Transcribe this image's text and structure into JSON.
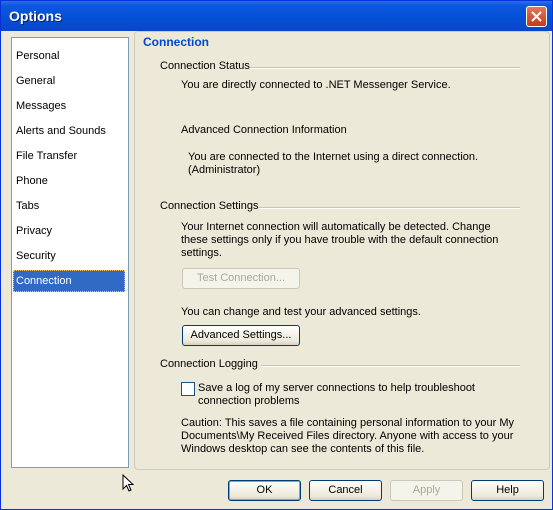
{
  "window": {
    "title": "Options"
  },
  "nav": {
    "items": [
      "Personal",
      "General",
      "Messages",
      "Alerts and Sounds",
      "File Transfer",
      "Phone",
      "Tabs",
      "Privacy",
      "Security",
      "Connection"
    ],
    "selected": "Connection"
  },
  "panel": {
    "title": "Connection",
    "status": {
      "heading": "Connection Status",
      "line1": "You are directly connected to .NET Messenger Service.",
      "advanced_heading": "Advanced Connection Information",
      "advanced_line1": "You are connected to the Internet using a direct connection.",
      "advanced_line2": "(Administrator)"
    },
    "settings": {
      "heading": "Connection Settings",
      "line1": "Your Internet connection will automatically be detected.  Change",
      "line2": "these settings only if you have trouble with the default connection",
      "line3": "settings.",
      "test_button": "Test Connection...",
      "advanced_text": "You can change and test your advanced settings.",
      "advanced_button": "Advanced Settings..."
    },
    "logging": {
      "heading": "Connection Logging",
      "checkbox_line1": "Save a log of my server connections to help troubleshoot",
      "checkbox_line2": "connection problems",
      "checkbox_checked": false,
      "caution1": "Caution:  This saves a file containing personal information to your My",
      "caution2": "Documents\\My Received Files directory.  Anyone with access to your",
      "caution3": "Windows desktop can see the contents of this file."
    }
  },
  "buttons": {
    "ok": "OK",
    "cancel": "Cancel",
    "apply": "Apply",
    "help": "Help"
  }
}
